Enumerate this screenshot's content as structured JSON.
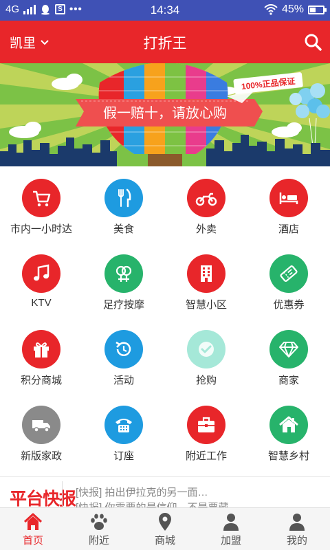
{
  "status_bar": {
    "network": "4G",
    "time": "14:34",
    "battery": "45%",
    "battery_level": 0.45
  },
  "header": {
    "city": "凯里",
    "title": "打折王",
    "search_icon": "search-icon"
  },
  "banner": {
    "slogan": "假一赔十，请放心购",
    "badge": "100%正品保证"
  },
  "grid": [
    {
      "label": "市内一小时达",
      "icon": "cart-icon",
      "color": "#e8262a"
    },
    {
      "label": "美食",
      "icon": "fork-knife-icon",
      "color": "#1e9be0"
    },
    {
      "label": "外卖",
      "icon": "motorcycle-icon",
      "color": "#e8262a"
    },
    {
      "label": "酒店",
      "icon": "bed-icon",
      "color": "#e8262a"
    },
    {
      "label": "KTV",
      "icon": "music-note-icon",
      "color": "#e8262a"
    },
    {
      "label": "足疗按摩",
      "icon": "gender-rings-icon",
      "color": "#27b36b"
    },
    {
      "label": "智慧小区",
      "icon": "building-icon",
      "color": "#e8262a"
    },
    {
      "label": "优惠券",
      "icon": "ticket-icon",
      "color": "#27b36b"
    },
    {
      "label": "积分商城",
      "icon": "gift-icon",
      "color": "#e8262a"
    },
    {
      "label": "活动",
      "icon": "refresh-clock-icon",
      "color": "#1e9be0"
    },
    {
      "label": "抢购",
      "icon": "check-icon",
      "color": "#a5e8d8"
    },
    {
      "label": "商家",
      "icon": "diamond-icon",
      "color": "#27b36b"
    },
    {
      "label": "新版家政",
      "icon": "truck-icon",
      "color": "#8a8a8a"
    },
    {
      "label": "订座",
      "icon": "phone-icon",
      "color": "#1e9be0"
    },
    {
      "label": "附近工作",
      "icon": "briefcase-icon",
      "color": "#e8262a"
    },
    {
      "label": "智慧乡村",
      "icon": "house-icon",
      "color": "#27b36b"
    }
  ],
  "news": {
    "logo": "平台快报",
    "items": [
      "[快报]  拍出伊拉克的另一面…",
      "[快报]  你需要的是信仰，不是票藏"
    ]
  },
  "bottom_nav": {
    "items": [
      {
        "label": "首页",
        "icon": "home-icon",
        "active": true
      },
      {
        "label": "附近",
        "icon": "paw-icon",
        "active": false
      },
      {
        "label": "商城",
        "icon": "location-pin-icon",
        "active": false
      },
      {
        "label": "加盟",
        "icon": "person-icon",
        "active": false
      },
      {
        "label": "我的",
        "icon": "person-icon",
        "active": false
      }
    ],
    "active_color": "#e8262a",
    "inactive_color": "#555555"
  }
}
